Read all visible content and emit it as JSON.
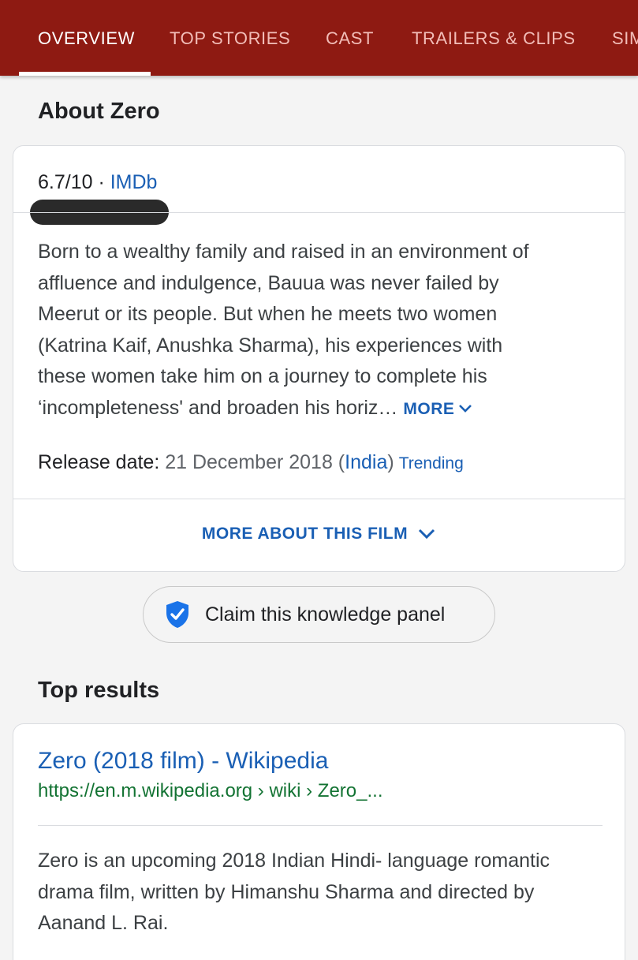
{
  "tabs": [
    {
      "label": "OVERVIEW",
      "active": true
    },
    {
      "label": "TOP STORIES",
      "active": false
    },
    {
      "label": "CAST",
      "active": false
    },
    {
      "label": "TRAILERS & CLIPS",
      "active": false
    },
    {
      "label": "SIMILAR",
      "active": false
    }
  ],
  "about": {
    "heading": "About Zero",
    "rating": {
      "value": "6.7/10",
      "separator": " · ",
      "source": "IMDb"
    },
    "description_lines": [
      "Born to a wealthy family and raised in an environment of",
      "affluence and indulgence, Bauua was never failed by",
      "Meerut or its people. But when he meets two women",
      "(Katrina Kaif, Anushka Sharma), his experiences with",
      "these women take him on a journey to complete his",
      "‘incompleteness' and broaden his horiz…"
    ],
    "more_label": "MORE",
    "release": {
      "label": "Release date: ",
      "date": "21 December 2018",
      "open_paren": " (",
      "country": "India",
      "close_paren": ")",
      "trending": "Trending"
    },
    "more_about_label": "MORE ABOUT THIS FILM"
  },
  "claim": {
    "label": "Claim this knowledge panel",
    "icon": "verified-shield-icon"
  },
  "top_results": {
    "heading": "Top results",
    "items": [
      {
        "title": "Zero (2018 film) - Wikipedia",
        "url": "https://en.m.wikipedia.org › wiki › Zero_...",
        "snippet_lines": [
          "Zero is an upcoming 2018 Indian Hindi- language romantic",
          "drama film, written by Himanshu Sharma and directed by",
          "Aanand L. Rai."
        ]
      }
    ]
  },
  "colors": {
    "tab_bar": "#8e1a12",
    "link_blue": "#1a5fb4",
    "url_green": "#137333",
    "shield_blue": "#1a73e8"
  }
}
